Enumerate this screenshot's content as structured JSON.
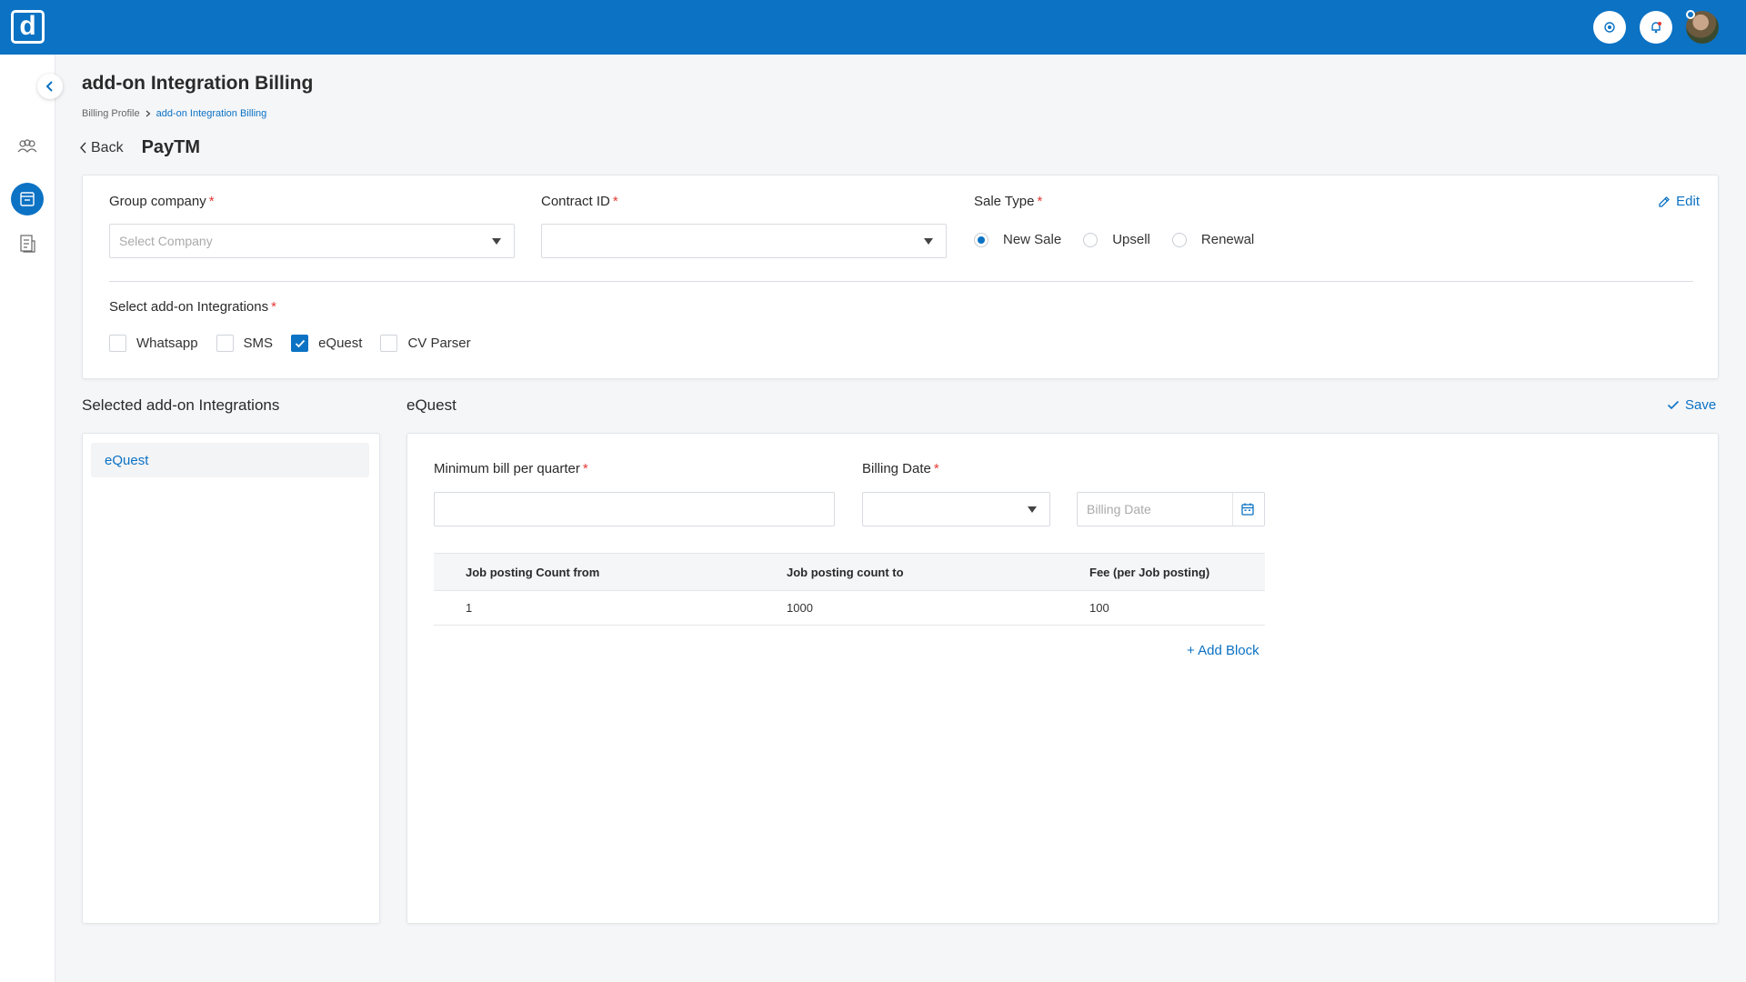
{
  "app": {
    "logo_text": "d",
    "icons": {
      "settings": "settings-icon",
      "notifications": "bell-icon"
    }
  },
  "sidebar": {
    "items": [
      {
        "icon": "users-icon"
      },
      {
        "icon": "billing-box-icon",
        "active": true
      },
      {
        "icon": "document-icon"
      }
    ]
  },
  "header": {
    "title": "add-on Integration Billing",
    "breadcrumb": [
      "Billing Profile",
      "add-on Integration Billing"
    ],
    "back_label": "Back",
    "company": "PayTM"
  },
  "form": {
    "group_company": {
      "label": "Group company",
      "required": "*",
      "placeholder": "Select Company"
    },
    "contract_id": {
      "label": "Contract ID",
      "required": "*",
      "value": ""
    },
    "sale_type": {
      "label": "Sale Type",
      "required": "*",
      "options": [
        "New Sale",
        "Upsell",
        "Renewal"
      ],
      "selected": "New Sale"
    },
    "edit_label": "Edit",
    "addons": {
      "label": "Select add-on Integrations",
      "required": "*",
      "options": [
        {
          "label": "Whatsapp",
          "checked": false
        },
        {
          "label": "SMS",
          "checked": false
        },
        {
          "label": "eQuest",
          "checked": true
        },
        {
          "label": "CV Parser",
          "checked": false
        }
      ]
    }
  },
  "selected_panel": {
    "title": "Selected add-on Integrations",
    "items": [
      "eQuest"
    ]
  },
  "detail_panel": {
    "title": "eQuest",
    "save_label": "Save",
    "min_bill": {
      "label": "Minimum bill per quarter",
      "required": "*",
      "value": ""
    },
    "billing_date": {
      "label": "Billing Date",
      "required": "*",
      "select_value": "",
      "date_placeholder": "Billing  Date"
    },
    "table": {
      "headers": [
        "Job posting Count from",
        "Job posting count to",
        "Fee (per Job posting)"
      ],
      "rows": [
        [
          "1",
          "1000",
          "100"
        ]
      ]
    },
    "add_block_label": "+ Add Block"
  }
}
